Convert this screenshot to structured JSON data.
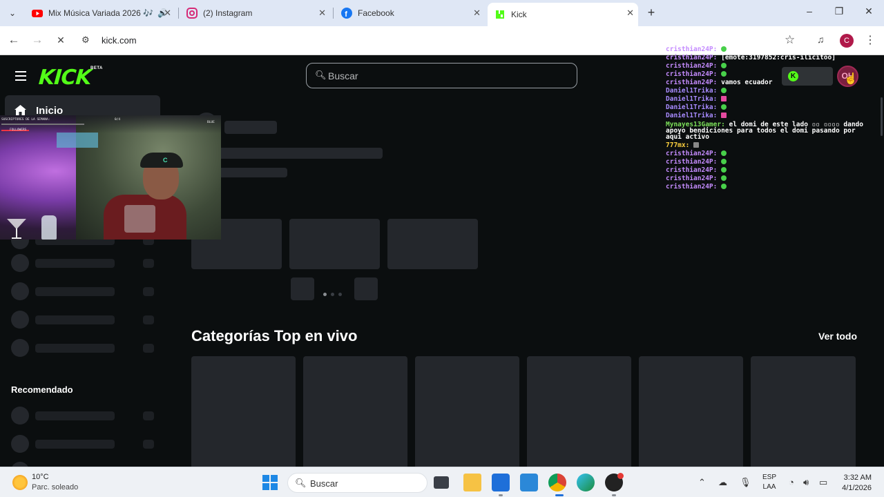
{
  "browser": {
    "tabs": [
      {
        "title": "Mix Música Variada 2026 🎶",
        "icon": "youtube-icon",
        "audio": true
      },
      {
        "title": "(2) Instagram",
        "icon": "instagram-icon"
      },
      {
        "title": "Facebook",
        "icon": "facebook-icon"
      },
      {
        "title": "Kick",
        "icon": "kick-icon",
        "active": true
      }
    ],
    "url": "kick.com",
    "profile_initial": "C"
  },
  "kick": {
    "logo": "KICK",
    "beta": "BETA",
    "search_placeholder": "Buscar",
    "user_avatar_initial": "OH",
    "sidebar": {
      "home_label": "Inicio",
      "recommended_label": "Recomendado"
    },
    "categories_title": "Categorías Top en vivo",
    "see_all": "Ver todo"
  },
  "cam_overlay": {
    "hud_left": "SUSCRIPTORES DE LA SEMANA:",
    "hud_left2": "FOLLOWERS",
    "hud_mid": "0/4",
    "hud_right": "BLUE",
    "cap_logo": "C"
  },
  "chat": [
    {
      "user": "cristhian24P:",
      "msg": "",
      "emote": "green",
      "color": "u"
    },
    {
      "user": "cristhian24P:",
      "msg": "[emote:3197852:cris-ilicitoo]",
      "color": "u"
    },
    {
      "user": "cristhian24P:",
      "msg": "",
      "emote": "green",
      "color": "u"
    },
    {
      "user": "cristhian24P:",
      "msg": "",
      "emote": "green",
      "color": "u"
    },
    {
      "user": "cristhian24P:",
      "msg": "vamos ecuador",
      "color": "u"
    },
    {
      "user": "Daniel1Trika:",
      "msg": "",
      "emote": "green",
      "color": "u2"
    },
    {
      "user": "Daniel1Trika:",
      "msg": "",
      "emote": "pink",
      "color": "u2"
    },
    {
      "user": "Daniel1Trika:",
      "msg": "",
      "emote": "green",
      "color": "u2"
    },
    {
      "user": "Daniel1Trika:",
      "msg": "",
      "emote": "pink",
      "color": "u2"
    },
    {
      "user": "Mynayes13Gamer:",
      "msg": "el domi de este lado ▫▫ ▫▫▫▫ dando apoyo bendiciones para todos el domi pasando por aqui activo",
      "color": "u3"
    },
    {
      "user": "777mx:",
      "msg": "",
      "emote": "grey",
      "color": "u4"
    },
    {
      "user": "cristhian24P:",
      "msg": "",
      "emote": "green",
      "color": "u"
    },
    {
      "user": "cristhian24P:",
      "msg": "",
      "emote": "green",
      "color": "u"
    },
    {
      "user": "cristhian24P:",
      "msg": "",
      "emote": "green",
      "color": "u"
    },
    {
      "user": "cristhian24P:",
      "msg": "",
      "emote": "green",
      "color": "u"
    },
    {
      "user": "cristhian24P:",
      "msg": "",
      "emote": "green",
      "color": "u"
    }
  ],
  "taskbar": {
    "weather_temp": "10°C",
    "weather_desc": "Parc. soleado",
    "search_label": "Buscar",
    "lang_1": "ESP",
    "lang_2": "LAA",
    "time": "3:32 AM",
    "date": "4/1/2026"
  },
  "colors": {
    "kick_green": "#53fc18",
    "page_bg": "#0b0e0f",
    "skeleton": "#24272c"
  }
}
